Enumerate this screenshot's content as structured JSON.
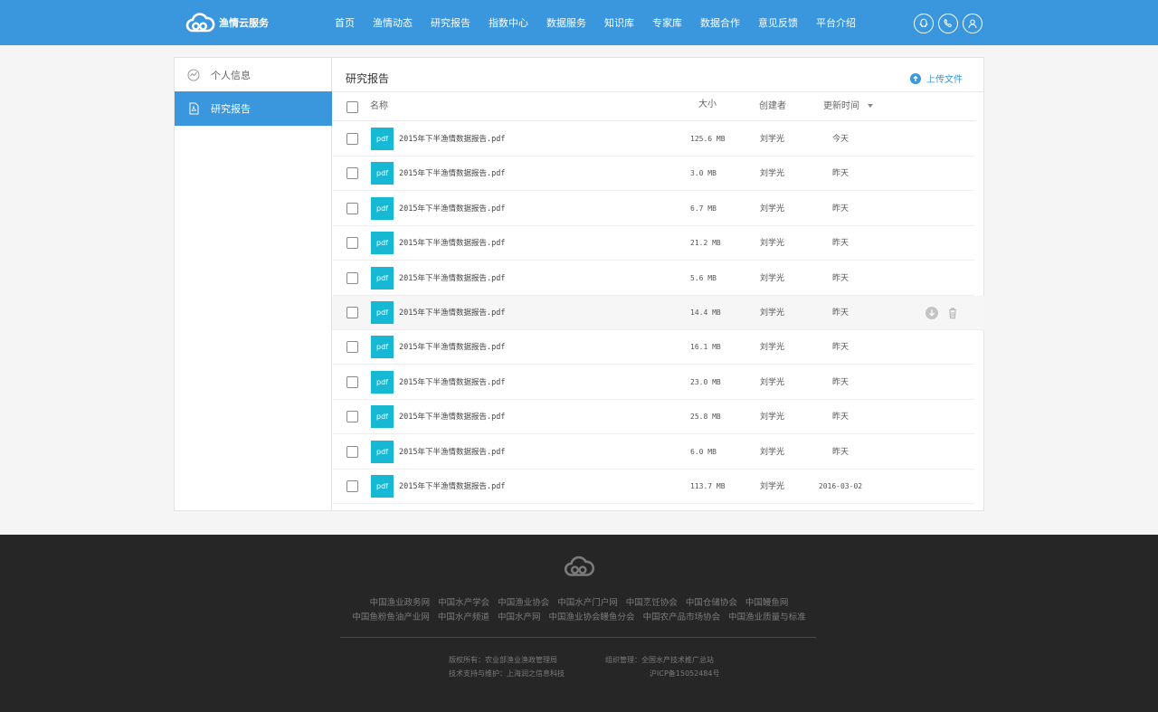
{
  "brand": {
    "name": "渔情云服务"
  },
  "nav": {
    "items": [
      "首页",
      "渔情动态",
      "研究报告",
      "指数中心",
      "数据服务",
      "知识库",
      "专家库",
      "数据合作",
      "意见反馈",
      "平台介绍"
    ]
  },
  "header_icons": [
    "qq-icon",
    "phone-icon",
    "user-icon"
  ],
  "sidebar": {
    "items": [
      {
        "label": "个人信息",
        "icon": "activity-icon",
        "active": false
      },
      {
        "label": "研究报告",
        "icon": "pdf-file-icon",
        "active": true
      }
    ]
  },
  "main": {
    "title": "研究报告",
    "upload_label": "上传文件",
    "columns": {
      "name": "名称",
      "size": "大小",
      "creator": "创建者",
      "updated": "更新时间"
    },
    "file_badge": "pdf",
    "files": [
      {
        "name": "2015年下半渔情数据报告.pdf",
        "size": "125.6 MB",
        "creator": "刘学光",
        "updated": "今天"
      },
      {
        "name": "2015年下半渔情数据报告.pdf",
        "size": "3.0 MB",
        "creator": "刘学光",
        "updated": "昨天"
      },
      {
        "name": "2015年下半渔情数据报告.pdf",
        "size": "6.7 MB",
        "creator": "刘学光",
        "updated": "昨天"
      },
      {
        "name": "2015年下半渔情数据报告.pdf",
        "size": "21.2 MB",
        "creator": "刘学光",
        "updated": "昨天"
      },
      {
        "name": "2015年下半渔情数据报告.pdf",
        "size": "5.6 MB",
        "creator": "刘学光",
        "updated": "昨天"
      },
      {
        "name": "2015年下半渔情数据报告.pdf",
        "size": "14.4 MB",
        "creator": "刘学光",
        "updated": "昨天"
      },
      {
        "name": "2015年下半渔情数据报告.pdf",
        "size": "16.1 MB",
        "creator": "刘学光",
        "updated": "昨天"
      },
      {
        "name": "2015年下半渔情数据报告.pdf",
        "size": "23.0 MB",
        "creator": "刘学光",
        "updated": "昨天"
      },
      {
        "name": "2015年下半渔情数据报告.pdf",
        "size": "25.8 MB",
        "creator": "刘学光",
        "updated": "昨天"
      },
      {
        "name": "2015年下半渔情数据报告.pdf",
        "size": "6.0 MB",
        "creator": "刘学光",
        "updated": "昨天"
      },
      {
        "name": "2015年下半渔情数据报告.pdf",
        "size": "113.7 MB",
        "creator": "刘学光",
        "updated": "2016-03-02"
      }
    ],
    "hover_row": 5
  },
  "footer": {
    "links_row1": [
      "中国渔业政务网",
      "中国水产学会",
      "中国渔业协会",
      "中国水产门户网",
      "中国烹饪协会",
      "中国仓储协会",
      "中国鳗鱼网"
    ],
    "links_row2": [
      "中国鱼粉鱼油产业网",
      "中国水产频道",
      "中国水产网",
      "中国渔业协会鳗鱼分会",
      "中国农产品市场协会",
      "中国渔业质量与标准"
    ],
    "copyright": "版权所有：农业部渔业渔政管理局",
    "support": "技术支持与维护：上海润之信息科技",
    "organizer": "组织管理：全国水产技术推广总站",
    "icp": "沪ICP备15052484号"
  },
  "colors": {
    "primary": "#3a96dd",
    "pdf_badge": "#17b8d4",
    "footer_bg": "#262626"
  }
}
